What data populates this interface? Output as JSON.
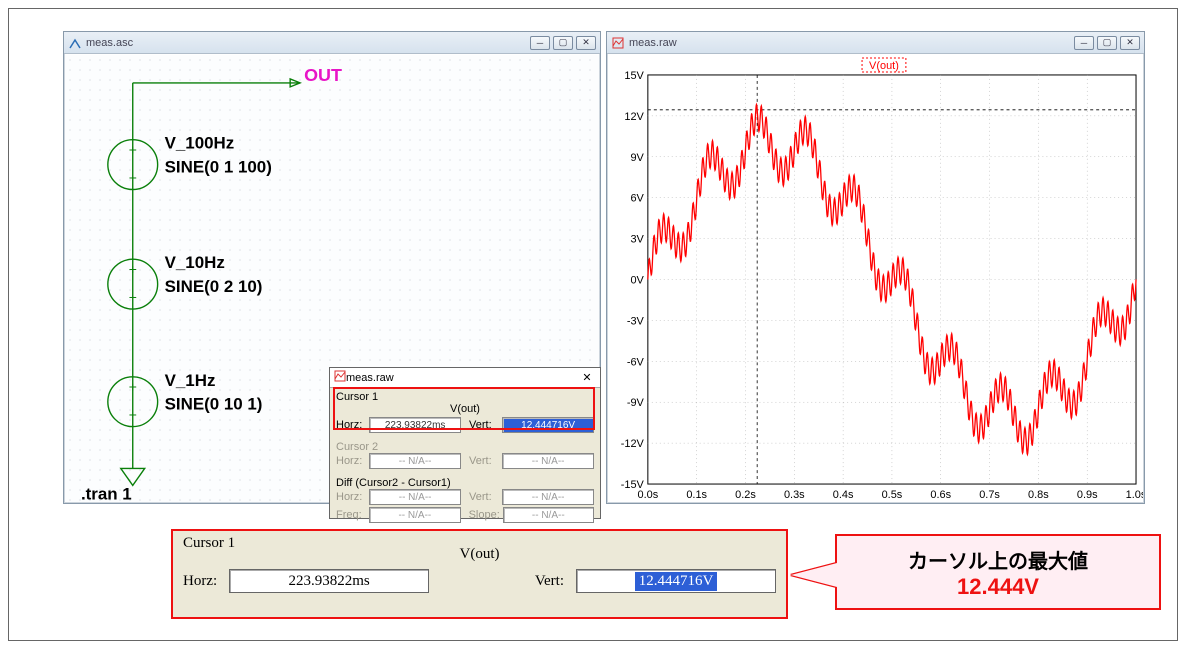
{
  "schematic_window": {
    "title": "meas.asc",
    "net_label": "OUT",
    "sources": [
      {
        "name": "V_100Hz",
        "value": "SINE(0 1 100)"
      },
      {
        "name": "V_10Hz",
        "value": "SINE(0 2 10)"
      },
      {
        "name": "V_1Hz",
        "value": "SINE(0 10 1)"
      }
    ],
    "directive": ".tran 1"
  },
  "cursor_dialog": {
    "title": "meas.raw",
    "groups": {
      "cursor1": {
        "label": "Cursor 1",
        "signal": "V(out)",
        "horz_label": "Horz:",
        "horz_value": "223.93822ms",
        "vert_label": "Vert:",
        "vert_value": "12.444716V"
      },
      "cursor2": {
        "label": "Cursor 2",
        "horz_label": "Horz:",
        "horz_value": "-- N/A--",
        "vert_label": "Vert:",
        "vert_value": "-- N/A--"
      },
      "diff": {
        "label": "Diff (Cursor2 - Cursor1)",
        "horz_label": "Horz:",
        "horz_value": "-- N/A--",
        "vert_label": "Vert:",
        "vert_value": "-- N/A--",
        "freq_label": "Freq:",
        "freq_value": "-- N/A--",
        "slope_label": "Slope:",
        "slope_value": "-- N/A--"
      }
    }
  },
  "plot_window": {
    "title": "meas.raw",
    "trace_label": "V(out)"
  },
  "enlarged": {
    "label": "Cursor 1",
    "signal": "V(out)",
    "horz_label": "Horz:",
    "horz_value": "223.93822ms",
    "vert_label": "Vert:",
    "vert_value": "12.444716V"
  },
  "callout": {
    "line1": "カーソル上の最大値",
    "line2": "12.444V"
  },
  "chart_data": {
    "type": "line",
    "title": "",
    "trace_name": "V(out)",
    "xlabel": "",
    "ylabel": "",
    "xlim": [
      0.0,
      1.0
    ],
    "ylim": [
      -15,
      15
    ],
    "xticks": [
      "0.0s",
      "0.1s",
      "0.2s",
      "0.3s",
      "0.4s",
      "0.5s",
      "0.6s",
      "0.7s",
      "0.8s",
      "0.9s",
      "1.0s"
    ],
    "yticks": [
      "15V",
      "12V",
      "9V",
      "6V",
      "3V",
      "0V",
      "-3V",
      "-6V",
      "-9V",
      "-12V",
      "-15V"
    ],
    "signal_model": {
      "description": "Sum of three sine components",
      "components": [
        {
          "amplitude": 10,
          "frequency_hz": 1,
          "dc_offset": 0
        },
        {
          "amplitude": 2,
          "frequency_hz": 10,
          "dc_offset": 0
        },
        {
          "amplitude": 1,
          "frequency_hz": 100,
          "dc_offset": 0
        }
      ]
    },
    "cursor": {
      "x_s": 0.22393822,
      "y_v": 12.444716
    },
    "trace_color": "#ff0000"
  }
}
